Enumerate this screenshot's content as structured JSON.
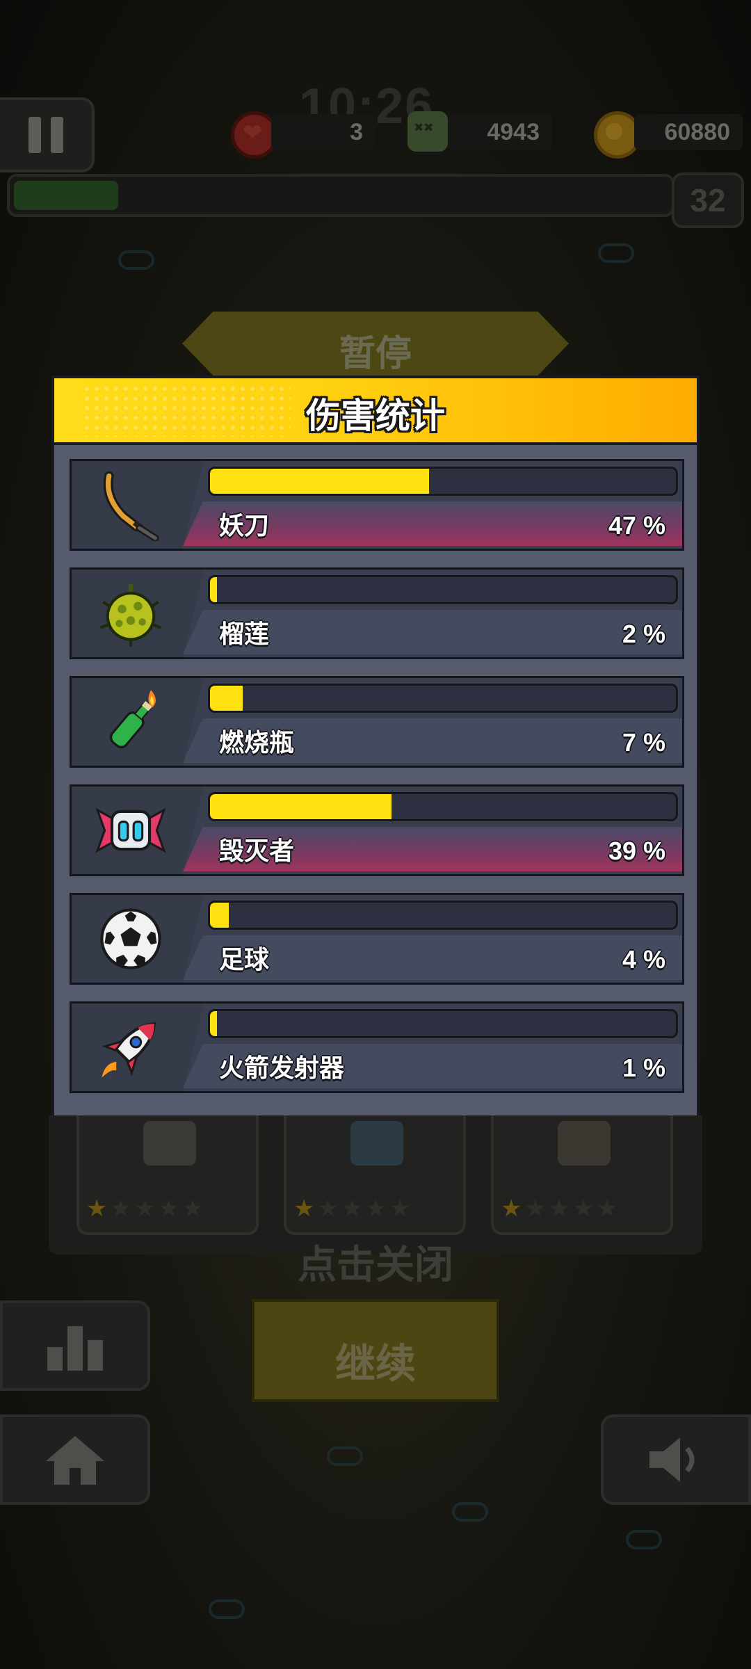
{
  "hud": {
    "clock": "10:26",
    "lives": "3",
    "kills": "4943",
    "coins": "60880",
    "level": "32"
  },
  "pause_banner": "暂停",
  "panel": {
    "title": "伤害统计",
    "rows": [
      {
        "name": "妖刀",
        "percent": "47 %",
        "value": 47,
        "icon": "katana-icon",
        "highlight": true
      },
      {
        "name": "榴莲",
        "percent": "2 %",
        "value": 2,
        "icon": "durian-icon",
        "highlight": false
      },
      {
        "name": "燃烧瓶",
        "percent": "7 %",
        "value": 7,
        "icon": "molotov-icon",
        "highlight": false
      },
      {
        "name": "毁灭者",
        "percent": "39 %",
        "value": 39,
        "icon": "destroyer-drone-icon",
        "highlight": true
      },
      {
        "name": "足球",
        "percent": "4 %",
        "value": 4,
        "icon": "soccer-ball-icon",
        "highlight": false
      },
      {
        "name": "火箭发射器",
        "percent": "1 %",
        "value": 1,
        "icon": "rocket-icon",
        "highlight": false
      }
    ]
  },
  "equipment": [
    {
      "icon": "vest-icon",
      "stars": 1
    },
    {
      "icon": "book-icon",
      "stars": 1
    },
    {
      "icon": "ammo-box-icon",
      "stars": 1
    }
  ],
  "tap_to_close": "点击关闭",
  "continue_label": "继续",
  "colors": {
    "header_yellow": "#ffd010",
    "bar_yellow": "#ffe10f",
    "panel": "#565c6e",
    "highlight": "#a2345c"
  }
}
